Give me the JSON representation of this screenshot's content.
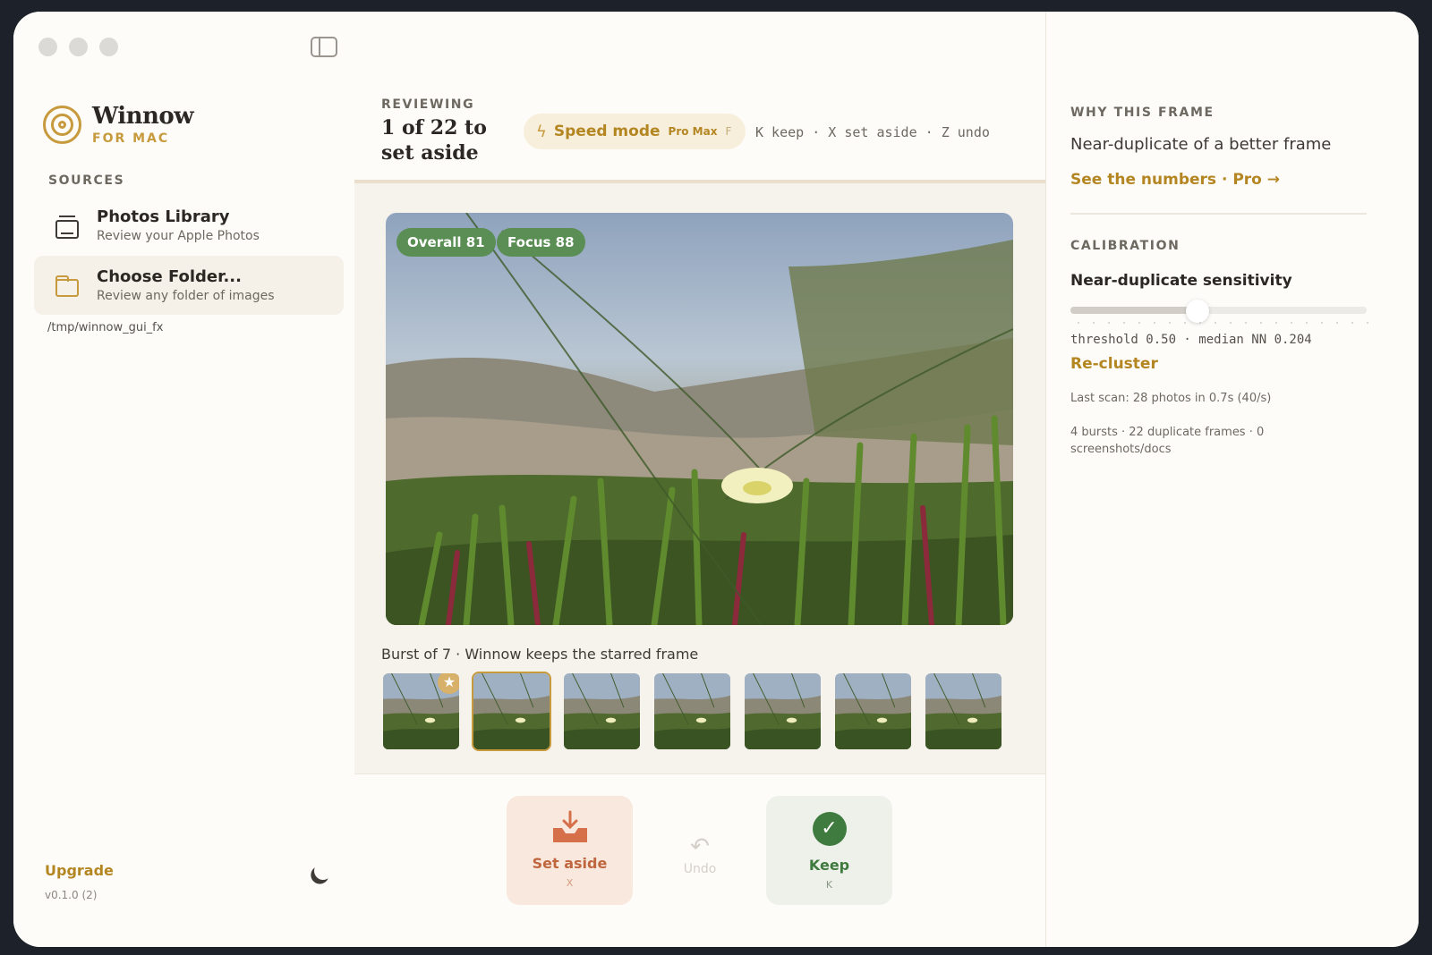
{
  "app": {
    "name": "Winnow",
    "subtitle": "FOR MAC",
    "accent_color": "#c79a3d"
  },
  "sidebar": {
    "sources_label": "SOURCES",
    "items": [
      {
        "title": "Photos Library",
        "description": "Review your Apple Photos",
        "icon": "photo-library-icon"
      },
      {
        "title": "Choose Folder...",
        "description": "Review any folder of images",
        "icon": "folder-icon"
      }
    ],
    "path": "/tmp/winnow_gui_fx",
    "upgrade_label": "Upgrade",
    "version": "v0.1.0 (2)"
  },
  "header": {
    "reviewing_label": "REVIEWING",
    "count_text": "1 of 22 to set aside",
    "speed_mode_label": "Speed mode",
    "speed_mode_tier": "Pro Max",
    "speed_mode_key": "F",
    "shortcut_hint": "K keep · X set aside · Z undo"
  },
  "photo": {
    "badges": [
      "Overall 81",
      "Focus 88"
    ],
    "burst_caption": "Burst of 7 · Winnow keeps the starred frame",
    "thumbnail_count": 7,
    "starred_index": 0,
    "selected_index": 1
  },
  "actions": {
    "set_aside_label": "Set aside",
    "set_aside_key": "X",
    "undo_label": "Undo",
    "keep_label": "Keep",
    "keep_key": "K"
  },
  "why": {
    "section_label": "WHY THIS FRAME",
    "reason": "Near-duplicate of a better frame",
    "link": "See the numbers · Pro →"
  },
  "calibration": {
    "section_label": "CALIBRATION",
    "sensitivity_label": "Near-duplicate sensitivity",
    "slider_value": 0.43,
    "threshold_text": "threshold 0.50 · median NN 0.204",
    "recluster_label": "Re-cluster",
    "last_scan": "Last scan: 28 photos in 0.7s (40/s)",
    "stats": "4 bursts · 22 duplicate frames · 0 screenshots/docs"
  }
}
